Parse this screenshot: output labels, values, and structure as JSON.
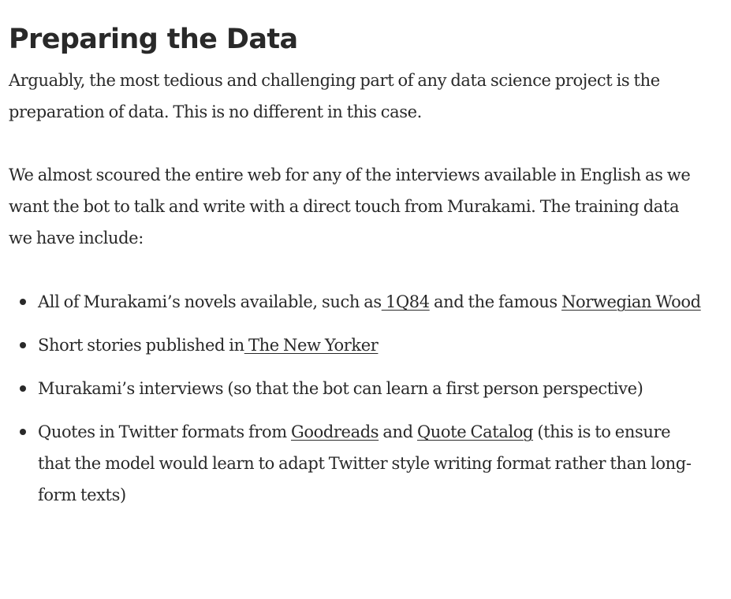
{
  "heading": "Preparing the Data",
  "paragraphs": [
    "Arguably, the most tedious and challenging part of any data science project is the preparation of data. This is no different in this case.",
    "We almost scoured the entire web for any of the interviews available in English as we want the bot to talk and write with a direct touch from Murakami. The training data we have include:"
  ],
  "list_items": [
    {
      "text_1": "All of Murakami’s novels available, such as",
      "link_1": " 1Q84",
      "text_2": " and the famous ",
      "link_2": "Norwegian Wood"
    },
    {
      "text_1": "Short stories published in",
      "link_1": " The New Yorker"
    },
    {
      "text_1": "Murakami’s interviews (so that the bot can learn a first person perspective)"
    },
    {
      "text_1": "Quotes in Twitter formats from ",
      "link_1": "Goodreads",
      "text_2": " and ",
      "link_2": "Quote Catalog",
      "text_3": " (this is to ensure that the model would learn to adapt Twitter style writing format rather than long-form texts)"
    }
  ]
}
